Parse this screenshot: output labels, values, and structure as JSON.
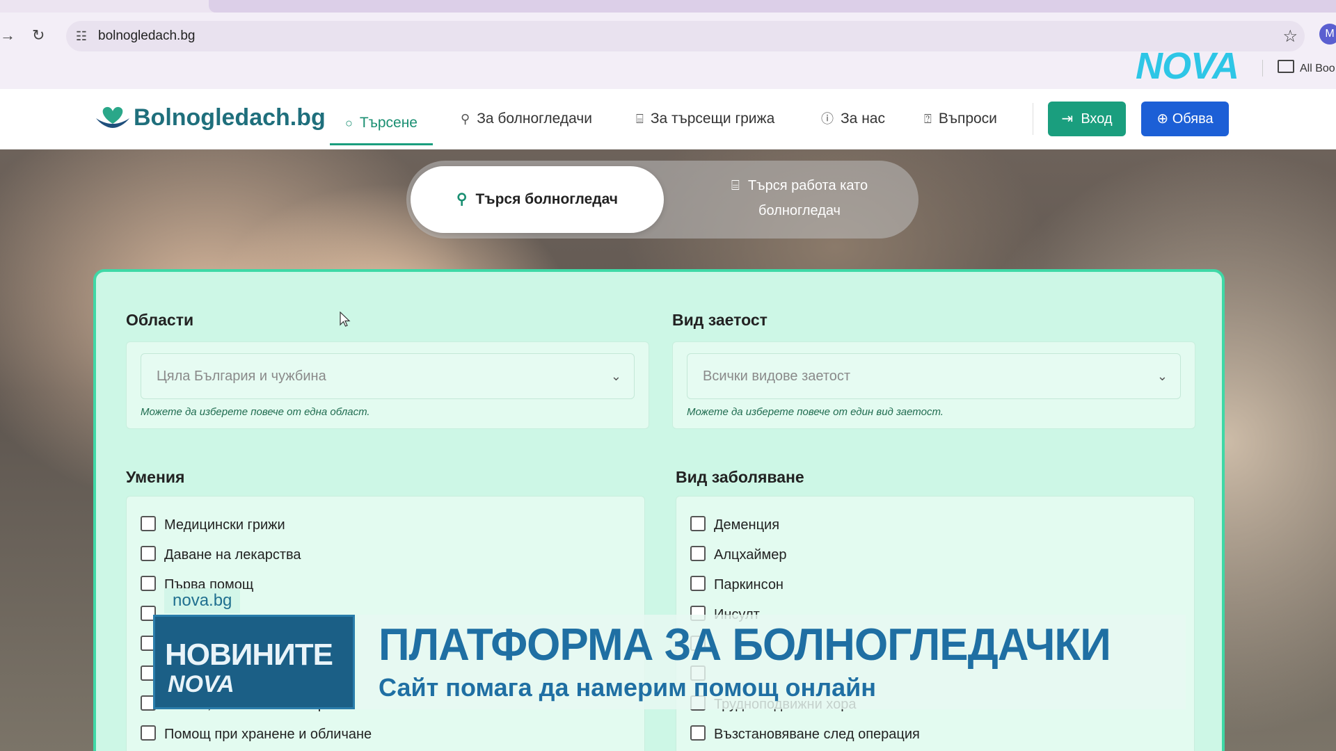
{
  "browser": {
    "url": "bolnogledach.bg",
    "profile_initial": "M",
    "bookmarks_label": "All Boo",
    "watermark": "NOVA"
  },
  "site": {
    "brand": "Bolnogledach.bg",
    "nav": [
      {
        "label": "Търсене",
        "icon": "search-icon",
        "active": true
      },
      {
        "label": "За болногледачи",
        "icon": "user-icon",
        "active": false
      },
      {
        "label": "За търсещи грижа",
        "icon": "bed-icon",
        "active": false
      },
      {
        "label": "За нас",
        "icon": "info-icon",
        "active": false
      },
      {
        "label": "Въпроси",
        "icon": "question-icon",
        "active": false
      }
    ],
    "login_label": "Вход",
    "ad_label": "Обява"
  },
  "toggle": {
    "active_label": "Търся болногледач",
    "inactive_label_line1": "Търся работа като",
    "inactive_label_line2": "болногледач"
  },
  "filters": {
    "regions": {
      "label": "Области",
      "value": "Цяла България и чужбина",
      "hint": "Можете да изберете повече от една област."
    },
    "employment": {
      "label": "Вид заетост",
      "value": "Всички видове заетост",
      "hint": "Можете да изберете повече от един вид заетост."
    },
    "skills": {
      "label": "Умения",
      "items": [
        "Медицински грижи",
        "Даване на лекарства",
        "Първа помощ",
        "",
        "",
        "",
        "Тоалет, смяна на памперси",
        "Помощ при хранене и обличане"
      ]
    },
    "diseases": {
      "label": "Вид заболяване",
      "items": [
        "Деменция",
        "Алцхаймер",
        "Паркинсон",
        "Инсулт",
        "",
        "",
        "Трудноподвижни хора",
        "Възстановяване след операция"
      ]
    }
  },
  "news_overlay": {
    "site": "nova.bg",
    "show_line1": "НОВИНИТЕ",
    "show_line2": "NOVA",
    "headline": "ПЛАТФОРМА ЗА БОЛНОГЛЕДАЧКИ",
    "subheadline": "Сайт помага да намерим помощ онлайн"
  }
}
